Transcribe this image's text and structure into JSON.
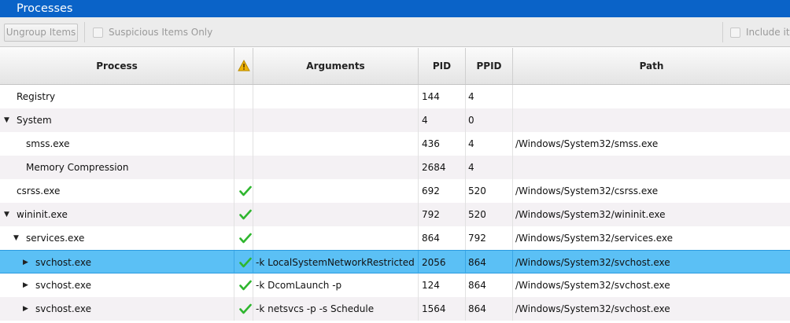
{
  "window": {
    "title": "Processes"
  },
  "toolbar": {
    "ungroup_label": "Ungroup Items",
    "suspicious_label": "Suspicious Items Only",
    "include_label": "Include ite"
  },
  "columns": {
    "process": "Process",
    "warning": "warning-icon",
    "arguments": "Arguments",
    "pid": "PID",
    "ppid": "PPID",
    "path": "Path"
  },
  "colors": {
    "accent": "#0a63c8",
    "selection": "#5bc0f5",
    "check": "#2fb62f",
    "warning": "#f0b400"
  },
  "rows": [
    {
      "process": "Registry",
      "indent": 0,
      "expander": "",
      "verified": false,
      "arguments": "",
      "pid": "144",
      "ppid": "4",
      "path": ""
    },
    {
      "process": "System",
      "indent": 0,
      "expander": "expanded",
      "verified": false,
      "arguments": "",
      "pid": "4",
      "ppid": "0",
      "path": ""
    },
    {
      "process": "smss.exe",
      "indent": 1,
      "expander": "",
      "verified": false,
      "arguments": "",
      "pid": "436",
      "ppid": "4",
      "path": "/Windows/System32/smss.exe"
    },
    {
      "process": "Memory Compression",
      "indent": 1,
      "expander": "",
      "verified": false,
      "arguments": "",
      "pid": "2684",
      "ppid": "4",
      "path": ""
    },
    {
      "process": "csrss.exe",
      "indent": 0,
      "expander": "",
      "verified": true,
      "arguments": "",
      "pid": "692",
      "ppid": "520",
      "path": "/Windows/System32/csrss.exe"
    },
    {
      "process": "wininit.exe",
      "indent": 0,
      "expander": "expanded",
      "verified": true,
      "arguments": "",
      "pid": "792",
      "ppid": "520",
      "path": "/Windows/System32/wininit.exe"
    },
    {
      "process": "services.exe",
      "indent": 1,
      "expander": "expanded",
      "verified": true,
      "arguments": "",
      "pid": "864",
      "ppid": "792",
      "path": "/Windows/System32/services.exe"
    },
    {
      "process": "svchost.exe",
      "indent": 2,
      "expander": "collapsed",
      "verified": true,
      "selected": true,
      "arguments": "-k LocalSystemNetworkRestricted -p...",
      "pid": "2056",
      "ppid": "864",
      "path": "/Windows/System32/svchost.exe"
    },
    {
      "process": "svchost.exe",
      "indent": 2,
      "expander": "collapsed",
      "verified": true,
      "arguments": "-k DcomLaunch -p",
      "pid": "124",
      "ppid": "864",
      "path": "/Windows/System32/svchost.exe"
    },
    {
      "process": "svchost.exe",
      "indent": 2,
      "expander": "collapsed",
      "verified": true,
      "arguments": "-k netsvcs -p -s Schedule",
      "pid": "1564",
      "ppid": "864",
      "path": "/Windows/System32/svchost.exe"
    }
  ]
}
